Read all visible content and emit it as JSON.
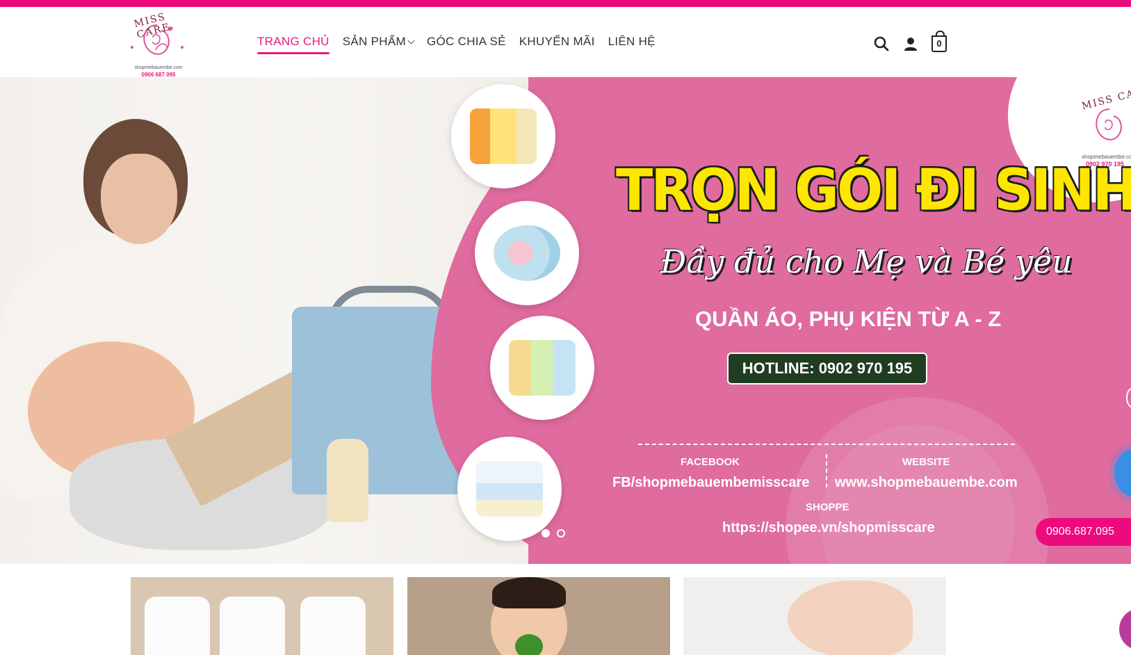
{
  "header": {
    "logo": {
      "brand": "MISS CARE",
      "site": "shopmebauembe.com",
      "phone": "0906 687 095"
    },
    "nav": [
      {
        "label": "TRANG CHỦ",
        "active": true
      },
      {
        "label": "SẢN PHẨM",
        "has_dropdown": true
      },
      {
        "label": "GÓC CHIA SẺ"
      },
      {
        "label": "KHUYẾN MÃI"
      },
      {
        "label": "LIÊN HỆ"
      }
    ],
    "cart_count": "0",
    "icons": [
      "search-icon",
      "user-icon",
      "cart-icon"
    ]
  },
  "hero": {
    "title": "TRỌN GÓI ĐI SINH",
    "subtitle": "Đầy đủ cho Mẹ và Bé yêu",
    "tagline": "QUẦN ÁO, PHỤ KIỆN TỪ A - Z",
    "hotline": "HOTLINE: 0902 970 195",
    "facebook_label": "FACEBOOK",
    "facebook_value": "FB/shopmebauembemisscare",
    "website_label": "WEBSITE",
    "website_value": "www.shopmebauembe.com",
    "shopee_label": "SHOPPE",
    "shopee_value": "https://shopee.vn/shopmisscare",
    "badge": {
      "brand": "MISS CARE",
      "site": "shopmebauembe.com",
      "phone": "0902 970 195"
    },
    "slides_total": 2,
    "slide_active": 1
  },
  "floating": {
    "phone": "0906.687.095"
  },
  "categories": [
    "baby-shirts",
    "baby-eating",
    "baby-feet"
  ],
  "colors": {
    "accent": "#ec0a7d",
    "hero_pink": "#df6b9f",
    "title_yellow": "#ffe600",
    "hotline_bg": "#1f3d21"
  }
}
